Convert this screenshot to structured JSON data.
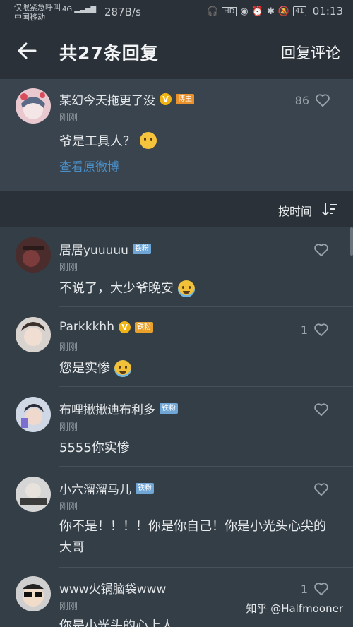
{
  "status_bar": {
    "carrier_line1": "仅限紧急呼叫",
    "carrier_line2": "中国移动",
    "network": "4G",
    "speed": "287B/s",
    "battery": "41",
    "time": "01:13"
  },
  "header": {
    "title": "共27条回复",
    "reply_button": "回复评论"
  },
  "original": {
    "username": "某幻今天拖更了没",
    "verified_mark": "V",
    "badge": "博主",
    "time": "刚刚",
    "text": "爷是工具人？",
    "link": "查看原微博",
    "likes": "86"
  },
  "sort": {
    "label": "按时间"
  },
  "replies": [
    {
      "username": "居居yuuuuu",
      "verified": "",
      "badge": "铁粉",
      "time": "刚刚",
      "text": "不说了，大少爷晚安",
      "likes": "",
      "emoji": "cry"
    },
    {
      "username": "Parkkkhh",
      "verified": "V",
      "badge": "铁粉",
      "time": "刚刚",
      "text": "您是实惨",
      "likes": "1",
      "emoji": "laugh-cry"
    },
    {
      "username": "布哩揪揪迪布利多",
      "verified": "",
      "badge": "铁粉",
      "time": "刚刚",
      "text": "5555你实惨",
      "likes": "",
      "emoji": ""
    },
    {
      "username": "小六溜溜马儿",
      "verified": "",
      "badge": "铁粉",
      "time": "刚刚",
      "text": "你不是！！！！你是你自己！你是小光头心尖的大哥",
      "likes": "",
      "emoji": ""
    },
    {
      "username": "www火锅脑袋www",
      "verified": "",
      "badge": "",
      "time": "刚刚",
      "text": "你是小光头的心上人",
      "likes": "1",
      "emoji": ""
    }
  ],
  "watermark": "知乎 @Halfmooner",
  "colors": {
    "background": "#343e47",
    "header": "#2a3138",
    "link": "#4a8fc8",
    "badge_blue": "#6fa6d6",
    "badge_orange": "#e9912d",
    "verified": "#f1b417"
  }
}
